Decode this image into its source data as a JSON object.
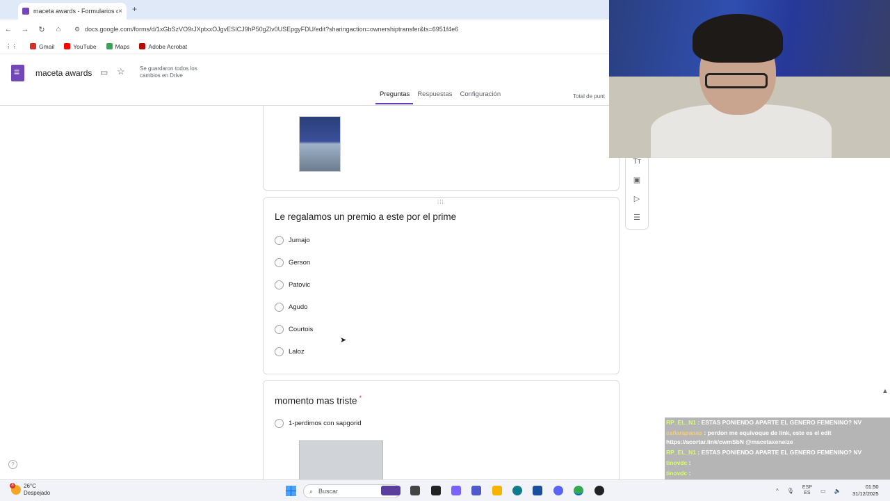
{
  "browser": {
    "tab_title": "maceta awards - Formularios d",
    "tab_close": "×",
    "new_tab": "+",
    "url": "docs.google.com/forms/d/1xGbSzVO9rJXptxxOJgvESICJ9hP50gZlv0USEpgyFDU/edit?sharingaction=ownershiptransfer&ts=6951f4e6",
    "bookmarks": [
      {
        "label": "Gmail",
        "color": "#d93025"
      },
      {
        "label": "YouTube",
        "color": "#ff0000"
      },
      {
        "label": "Maps",
        "color": "#34a853"
      },
      {
        "label": "Adobe Acrobat",
        "color": "#b30b00"
      }
    ]
  },
  "form_header": {
    "title": "maceta awards",
    "saved_status": "Se guardaron todos los cambios en Drive",
    "tabs": [
      {
        "label": "Preguntas",
        "active": true
      },
      {
        "label": "Respuestas",
        "active": false
      },
      {
        "label": "Configuración",
        "active": false
      }
    ],
    "points": "Total de punt"
  },
  "question1": {
    "title": "Le regalamos un premio a este por el prime",
    "options": [
      "Jumajo",
      "Gerson",
      "Patovic",
      "Agudo",
      "Courtois",
      "Laloz"
    ]
  },
  "question2": {
    "title": "momento mas triste",
    "required_mark": "*",
    "options": [
      "1-perdimos con sapgorid"
    ]
  },
  "chat": [
    {
      "user": "RP_EL_N1",
      "message": ": ESTAS PONIENDO APARTE EL GENERO FEMENINO? NV"
    },
    {
      "user": "cañarapanas",
      "message": ": perdon me equivoque de link, este es el edit"
    },
    {
      "user": "",
      "message": "https://acortar.link/cwmSbN @macetaxeneize"
    },
    {
      "user": "RP_EL_N1",
      "message": ": ESTAS PONIENDO APARTE EL GENERO FEMENINO? NV"
    },
    {
      "user": "tinovdc",
      "message": ":"
    },
    {
      "user": "tinovdc",
      "message": ":"
    },
    {
      "user": "tinovdc",
      "message": ":"
    },
    {
      "user": "tinovdc",
      "message": ":"
    }
  ],
  "taskbar": {
    "weather_temp": "26°C",
    "weather_desc": "Despejado",
    "weather_badge": "8",
    "search_placeholder": "Buscar",
    "lang_top": "ESP",
    "lang_bottom": "ES",
    "time": "01:50",
    "date": "31/12/2025"
  },
  "colors": {
    "accent": "#673ab7",
    "forms_brand": "#7248b9"
  }
}
